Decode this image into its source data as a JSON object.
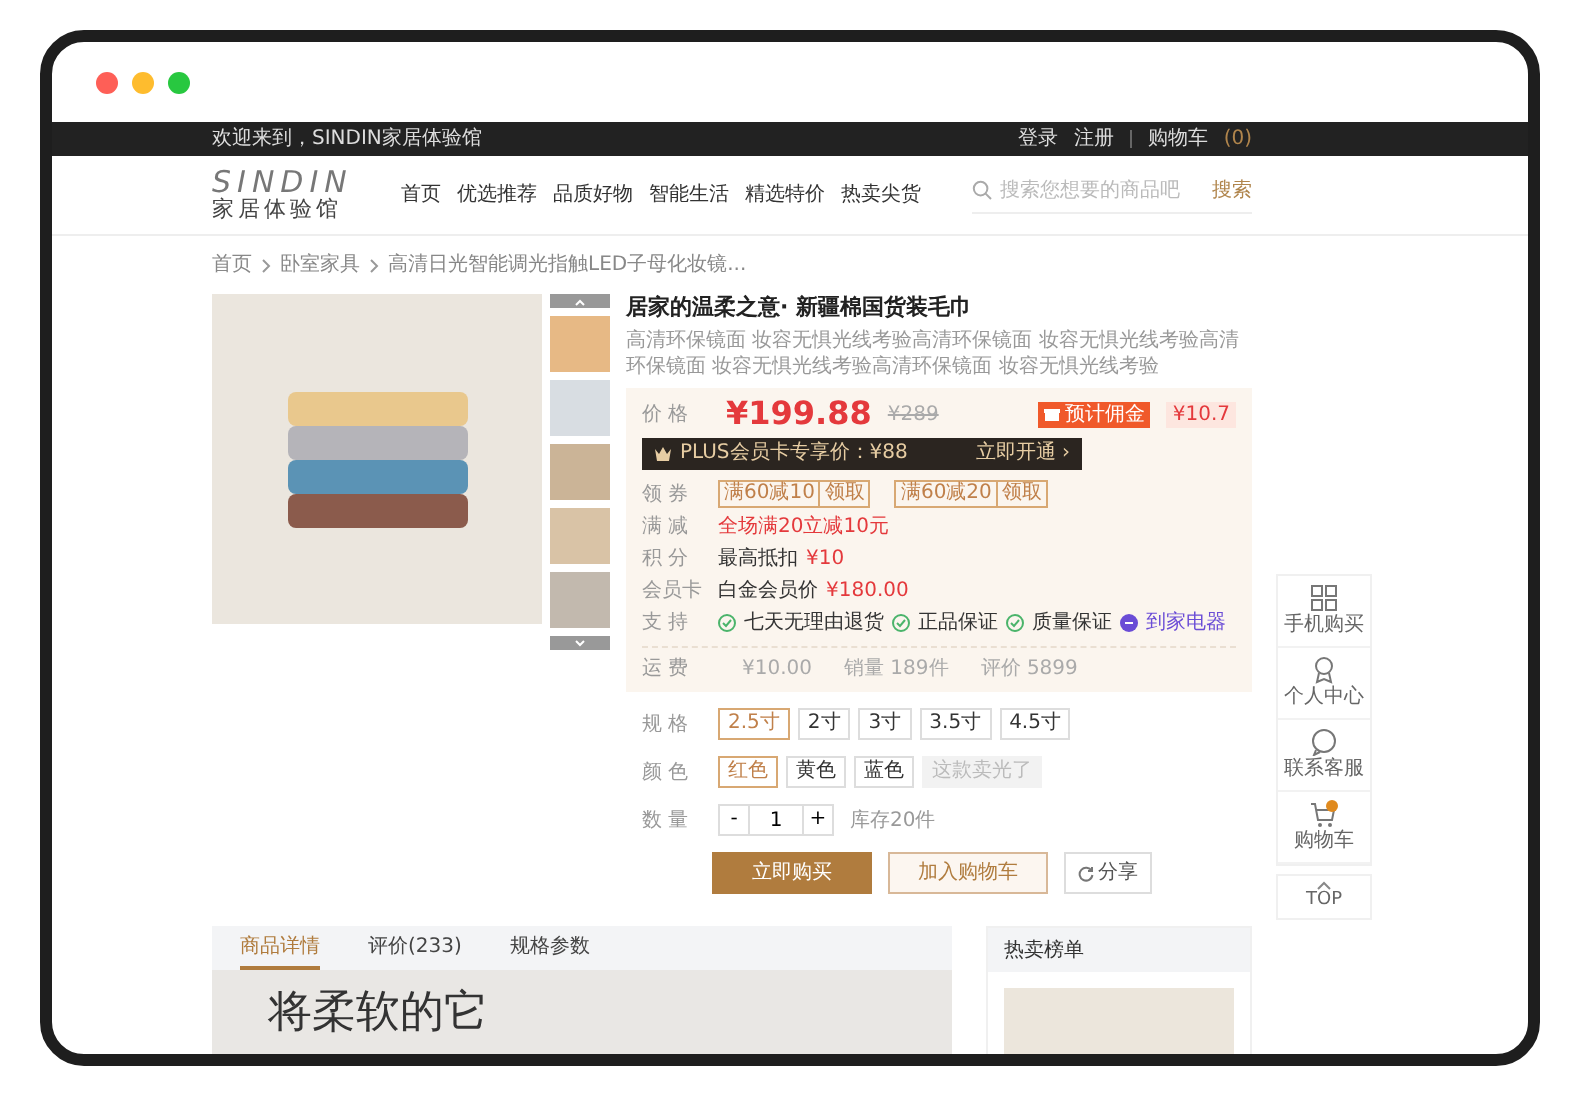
{
  "top_bar": {
    "welcome": "欢迎来到，SINDIN家居体验馆",
    "links": [
      "登录",
      "注册"
    ],
    "cart_label": "购物车",
    "cart_count": "(0)"
  },
  "header": {
    "logo_wordmark": "SINDIN",
    "logo_subtitle": "家居体验馆",
    "nav": [
      "首页",
      "优选推荐",
      "品质好物",
      "智能生活",
      "精选特价",
      "热卖尖货"
    ],
    "search": {
      "placeholder": "搜索您想要的商品吧",
      "button": "搜索"
    }
  },
  "breadcrumb": [
    "首页",
    "卧室家具",
    "高清日光智能调光指触LED子母化妆镜..."
  ],
  "product": {
    "title": "居家的温柔之意· 新疆棉国货装毛巾",
    "description": "高清环保镜面 妆容无惧光线考验高清环保镜面 妆容无惧光线考验高清环保镜面 妆容无惧光线考验高清环保镜面 妆容无惧光线考验",
    "price_label": "价 格",
    "price": "¥199.88",
    "original_price": "¥289",
    "commission_badge": "预计佣金",
    "commission": "¥10.7",
    "plus": {
      "text": "PLUS会员卡专享价：¥88",
      "action": "立即开通 ›"
    },
    "rows": [
      {
        "label": "领 券",
        "kind": "coupons",
        "coupons": [
          {
            "text": "满60减10",
            "action": "领取"
          },
          {
            "text": "满60减20",
            "action": "领取"
          }
        ]
      },
      {
        "label": "满 减",
        "kind": "promo",
        "text": "全场满20立减10元"
      },
      {
        "label": "积 分",
        "kind": "amount",
        "text": "最高抵扣",
        "amount": "¥10"
      },
      {
        "label": "会员卡",
        "kind": "amount",
        "text": "白金会员价",
        "amount": "¥180.00"
      },
      {
        "label": "支 持",
        "kind": "services",
        "items": [
          {
            "text": "七天无理由退货",
            "kind": "check"
          },
          {
            "text": "正品保证",
            "kind": "check"
          },
          {
            "text": "质量保证",
            "kind": "check"
          },
          {
            "text": "到家电器",
            "kind": "brand"
          }
        ]
      }
    ],
    "stats": {
      "label": "运 费",
      "items": [
        "¥10.00",
        "销量 189件",
        "评价 5899"
      ]
    }
  },
  "options": [
    {
      "label": "规 格",
      "choices": [
        {
          "text": "2.5寸",
          "selected": true,
          "disabled": false
        },
        {
          "text": "2寸",
          "selected": false,
          "disabled": false
        },
        {
          "text": "3寸",
          "selected": false,
          "disabled": false
        },
        {
          "text": "3.5寸",
          "selected": false,
          "disabled": false
        },
        {
          "text": "4.5寸",
          "selected": false,
          "disabled": false
        }
      ]
    },
    {
      "label": "颜 色",
      "choices": [
        {
          "text": "红色",
          "selected": true,
          "disabled": false
        },
        {
          "text": "黄色",
          "selected": false,
          "disabled": false
        },
        {
          "text": "蓝色",
          "selected": false,
          "disabled": false
        },
        {
          "text": "这款卖光了",
          "selected": false,
          "disabled": true
        }
      ]
    }
  ],
  "quantity": {
    "label": "数 量",
    "minus": "-",
    "value": "1",
    "plus": "+",
    "stock": "库存20件"
  },
  "actions": {
    "buy": "立即购买",
    "cart": "加入购物车",
    "share": "分享"
  },
  "side_toolbar": [
    {
      "label": "手机购买",
      "kind": "qr"
    },
    {
      "label": "个人中心",
      "kind": "user"
    },
    {
      "label": "联系客服",
      "kind": "chat"
    },
    {
      "label": "购物车",
      "kind": "cart"
    }
  ],
  "top_button": {
    "label": "TOP"
  },
  "detail_tabs": [
    {
      "label": "商品详情",
      "selected": true
    },
    {
      "label": "评价(233)",
      "selected": false
    },
    {
      "label": "规格参数",
      "selected": false
    }
  ],
  "detail_banner": {
    "heading": "将柔软的它"
  },
  "hot_list": {
    "title": "热卖榜单"
  }
}
